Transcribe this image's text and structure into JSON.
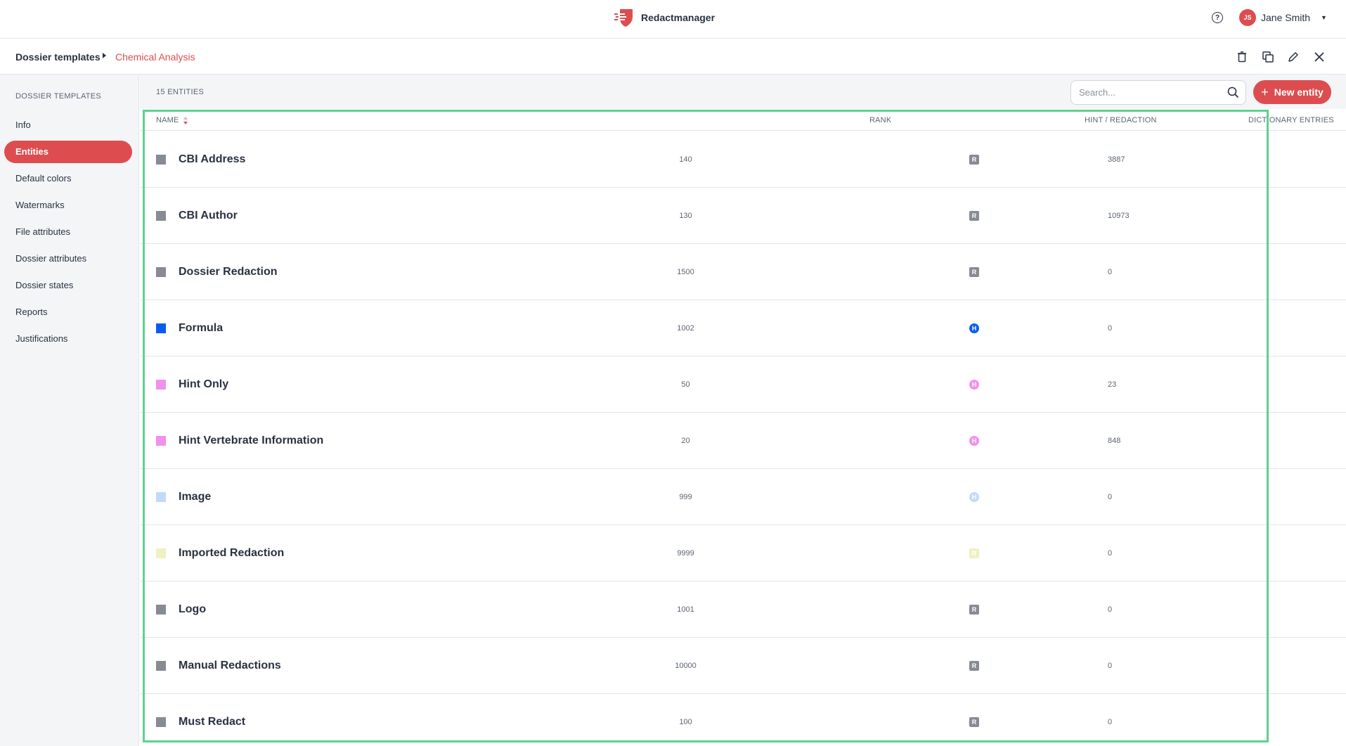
{
  "app": {
    "name": "Redactmanager",
    "brand_color": "#dd4d50"
  },
  "topbar": {
    "help_icon": "help-circle-icon",
    "user": {
      "initials": "JS",
      "name": "Jane Smith"
    }
  },
  "breadcrumb": {
    "root": "Dossier templates",
    "current": "Chemical Analysis",
    "actions": [
      "delete-icon",
      "copy-icon",
      "edit-icon",
      "close-icon"
    ]
  },
  "sidebar": {
    "header": "DOSSIER TEMPLATES",
    "items": [
      {
        "label": "Info",
        "active": false
      },
      {
        "label": "Entities",
        "active": true
      },
      {
        "label": "Default colors",
        "active": false
      },
      {
        "label": "Watermarks",
        "active": false
      },
      {
        "label": "File attributes",
        "active": false
      },
      {
        "label": "Dossier attributes",
        "active": false
      },
      {
        "label": "Dossier states",
        "active": false
      },
      {
        "label": "Reports",
        "active": false
      },
      {
        "label": "Justifications",
        "active": false
      }
    ]
  },
  "main": {
    "count_label": "15 ENTITIES",
    "search_placeholder": "Search...",
    "new_button_label": "New entity",
    "columns": [
      "NAME",
      "RANK",
      "HINT / REDACTION",
      "DICTIONARY ENTRIES"
    ],
    "rows": [
      {
        "name": "CBI Address",
        "rank": "140",
        "type": "R",
        "dictionary_entries": "3887",
        "color": "#868b94"
      },
      {
        "name": "CBI Author",
        "rank": "130",
        "type": "R",
        "dictionary_entries": "10973",
        "color": "#868b94"
      },
      {
        "name": "Dossier Redaction",
        "rank": "1500",
        "type": "R",
        "dictionary_entries": "0",
        "color": "#868b94"
      },
      {
        "name": "Formula",
        "rank": "1002",
        "type": "H",
        "dictionary_entries": "0",
        "color": "#0a5cf0"
      },
      {
        "name": "Hint Only",
        "rank": "50",
        "type": "H",
        "dictionary_entries": "23",
        "color": "#f28ff0"
      },
      {
        "name": "Hint Vertebrate Information",
        "rank": "20",
        "type": "H",
        "dictionary_entries": "848",
        "color": "#f28ff0"
      },
      {
        "name": "Image",
        "rank": "999",
        "type": "H",
        "dictionary_entries": "0",
        "color": "#c2d9fa"
      },
      {
        "name": "Imported Redaction",
        "rank": "9999",
        "type": "R",
        "dictionary_entries": "0",
        "color": "#f0f0c2"
      },
      {
        "name": "Logo",
        "rank": "1001",
        "type": "R",
        "dictionary_entries": "0",
        "color": "#868b94"
      },
      {
        "name": "Manual Redactions",
        "rank": "10000",
        "type": "R",
        "dictionary_entries": "0",
        "color": "#868b94"
      },
      {
        "name": "Must Redact",
        "rank": "100",
        "type": "R",
        "dictionary_entries": "0",
        "color": "#868b94"
      }
    ]
  }
}
